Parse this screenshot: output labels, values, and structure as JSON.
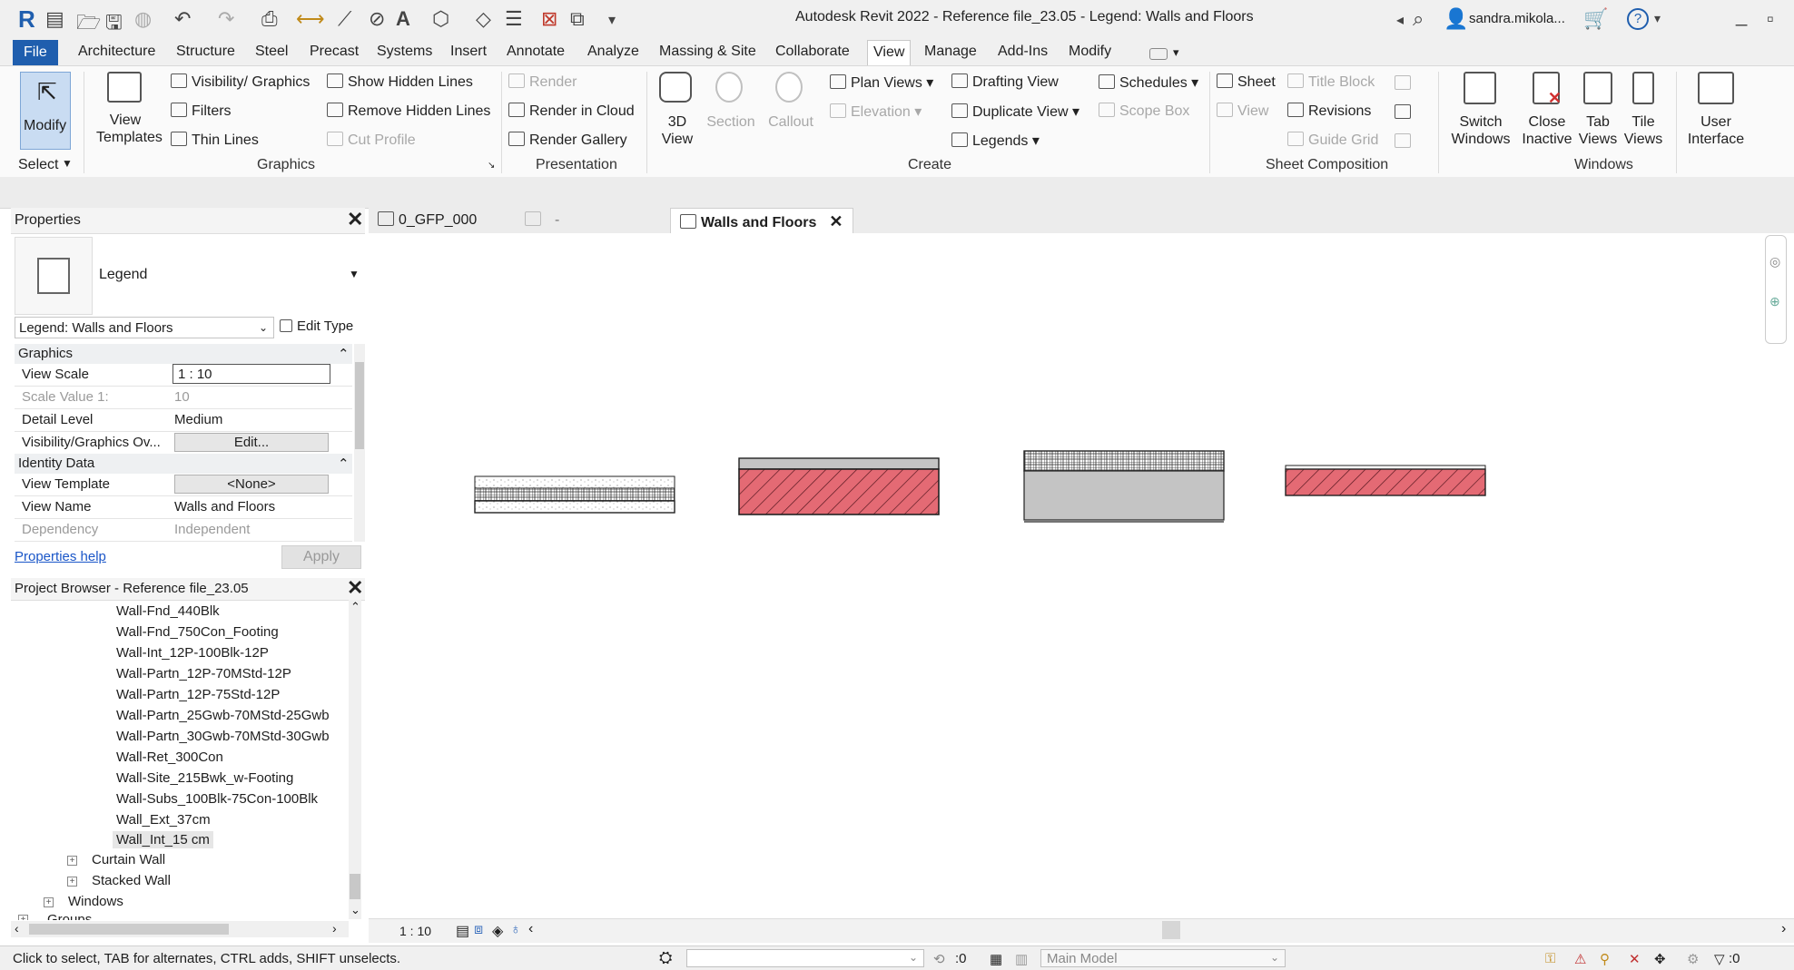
{
  "app": {
    "title": "Autodesk Revit 2022 - Reference file_23.05 - Legend: Walls and Floors",
    "user": "sandra.mikola...",
    "help": "?"
  },
  "menu": {
    "file": "File",
    "tabs": [
      "Architecture",
      "Structure",
      "Steel",
      "Precast",
      "Systems",
      "Insert",
      "Annotate",
      "Analyze",
      "Massing & Site",
      "Collaborate",
      "View",
      "Manage",
      "Add-Ins",
      "Modify"
    ],
    "active": "View"
  },
  "ribbon": {
    "modify": "Modify",
    "select": "Select",
    "view_templates": [
      "View",
      "Templates"
    ],
    "graphics": {
      "visibility": "Visibility/ Graphics",
      "filters": "Filters",
      "thin_lines": "Thin  Lines",
      "show_hidden": "Show  Hidden Lines",
      "remove_hidden": "Remove  Hidden Lines",
      "cut_profile": "Cut  Profile",
      "label": "Graphics"
    },
    "presentation": {
      "render": "Render",
      "render_cloud": "Render  in Cloud",
      "render_gallery": "Render  Gallery",
      "label": "Presentation"
    },
    "create": {
      "view3d": [
        "3D",
        "View"
      ],
      "section": "Section",
      "callout": "Callout",
      "plan_views": "Plan  Views",
      "elevation": "Elevation",
      "drafting_view": "Drafting  View",
      "duplicate_view": "Duplicate  View",
      "legends": "Legends",
      "schedules": "Schedules",
      "scope_box": "Scope  Box",
      "label": "Create"
    },
    "sheet": {
      "sheet": "Sheet",
      "title_block": "Title  Block",
      "view": "View",
      "revisions": "Revisions",
      "guide_grid": "Guide  Grid",
      "label": "Sheet Composition"
    },
    "windows": {
      "switch": [
        "Switch",
        "Windows"
      ],
      "close_inactive": [
        "Close",
        "Inactive"
      ],
      "tab_views": [
        "Tab",
        "Views"
      ],
      "tile_views": [
        "Tile",
        "Views"
      ],
      "user_interface": [
        "User",
        "Interface"
      ],
      "label": "Windows"
    }
  },
  "properties": {
    "title": "Properties",
    "type_name": "Legend",
    "instance": "Legend: Walls and Floors",
    "edit_type": "Edit Type",
    "groups": {
      "graphics": "Graphics",
      "identity": "Identity Data"
    },
    "rows": {
      "view_scale": {
        "k": "View Scale",
        "v": "1 : 10"
      },
      "scale_value": {
        "k": "Scale Value    1:",
        "v": "10"
      },
      "detail_level": {
        "k": "Detail Level",
        "v": "Medium"
      },
      "vis_graphics": {
        "k": "Visibility/Graphics Ov...",
        "v": "Edit..."
      },
      "view_template": {
        "k": "View Template",
        "v": "<None>"
      },
      "view_name": {
        "k": "View Name",
        "v": "Walls and Floors"
      },
      "dependency": {
        "k": "Dependency",
        "v": "Independent"
      }
    },
    "help": "Properties help",
    "apply": "Apply"
  },
  "browser": {
    "title": "Project Browser - Reference file_23.05",
    "items": [
      "Wall-Fnd_440Blk",
      "Wall-Fnd_750Con_Footing",
      "Wall-Int_12P-100Blk-12P",
      "Wall-Partn_12P-70MStd-12P",
      "Wall-Partn_12P-75Std-12P",
      "Wall-Partn_25Gwb-70MStd-25Gwb",
      "Wall-Partn_30Gwb-70MStd-30Gwb",
      "Wall-Ret_300Con",
      "Wall-Site_215Bwk_w-Footing",
      "Wall-Subs_100Blk-75Con-100Blk",
      "Wall_Ext_37cm",
      "Wall_Int_15 cm"
    ],
    "families": [
      "Curtain Wall",
      "Stacked Wall"
    ],
    "categories": [
      "Windows",
      "Groups"
    ]
  },
  "view_tabs": [
    "0_GFP_000",
    "-",
    "Walls and Floors"
  ],
  "view_bar": {
    "scale": "1 : 10"
  },
  "status": {
    "hint": "Click to select, TAB for alternates, CTRL adds, SHIFT unselects.",
    "counter": ":0",
    "model": "Main Model",
    "filter_count": ":0"
  },
  "colors": {
    "file_blue": "#1f5eae",
    "hatch_red": "#e46a74",
    "wall_gray": "#c4c4c4"
  }
}
